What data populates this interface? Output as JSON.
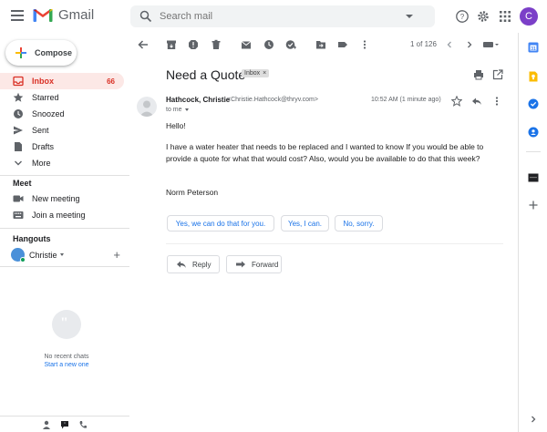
{
  "app": {
    "name": "Gmail",
    "avatar_letter": "C"
  },
  "search": {
    "placeholder": "Search mail"
  },
  "compose": {
    "label": "Compose"
  },
  "nav": {
    "items": [
      {
        "label": "Inbox",
        "count": "66",
        "icon": "inbox-icon",
        "active": true
      },
      {
        "label": "Starred",
        "icon": "star-icon"
      },
      {
        "label": "Snoozed",
        "icon": "clock-icon"
      },
      {
        "label": "Sent",
        "icon": "send-icon"
      },
      {
        "label": "Drafts",
        "icon": "draft-icon"
      },
      {
        "label": "More",
        "icon": "chevron-down-icon"
      }
    ]
  },
  "meet": {
    "title": "Meet",
    "new_meeting": "New meeting",
    "join_meeting": "Join a meeting"
  },
  "hangouts": {
    "title": "Hangouts",
    "user": "Christie",
    "no_chats": "No recent chats",
    "start_new": "Start a new one"
  },
  "toolbar": {
    "pager": "1 of 126"
  },
  "email": {
    "subject": "Need a Quote",
    "label": "Inbox",
    "sender_name": "Hathcock, Christie",
    "sender_email": "<Christie.Hathcock@thryv.com>",
    "to": "to me",
    "time": "10:52 AM (1 minute ago)",
    "greeting": "Hello!",
    "body": "I have a water heater that needs to be replaced and I wanted to know If you would be able to provide a quote for what that would cost? Also, would you be available to do that this week?",
    "signature": "Norm Peterson"
  },
  "smart_replies": [
    "Yes, we can do that for you.",
    "Yes, I can.",
    "No, sorry."
  ],
  "actions": {
    "reply": "Reply",
    "forward": "Forward"
  },
  "colors": {
    "accent_red": "#d93025",
    "link_blue": "#1a73e8",
    "active_bg": "#fce8e6"
  }
}
